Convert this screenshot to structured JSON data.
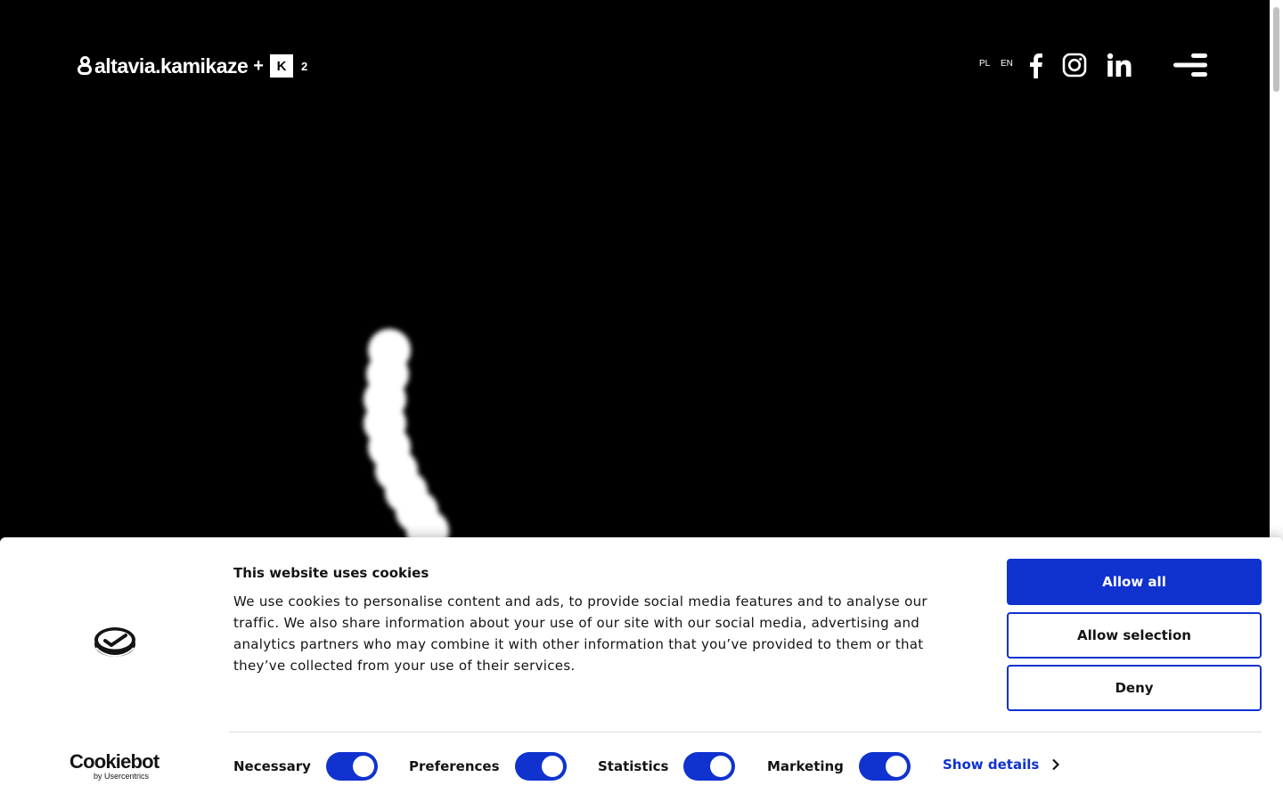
{
  "header": {
    "logo": {
      "brand": "altavia.kamikaze",
      "plus": "+",
      "k_box": "K",
      "superscript": "2"
    },
    "languages": [
      "PL",
      "EN"
    ],
    "social_icons": [
      "facebook-icon",
      "instagram-icon",
      "linkedin-icon"
    ],
    "menu_icon": "hamburger-menu-icon"
  },
  "cookie_banner": {
    "title": "This website uses cookies",
    "body": "We use cookies to personalise content and ads, to provide social media features and to analyse our traffic. We also share information about your use of our site with our social media, advertising and analytics partners who may combine it with other information that you’ve provided to them or that they’ve collected from your use of their services.",
    "buttons": {
      "allow_all": "Allow all",
      "allow_selection": "Allow selection",
      "deny": "Deny"
    },
    "toggles": [
      {
        "label": "Necessary",
        "checked": true
      },
      {
        "label": "Preferences",
        "checked": true
      },
      {
        "label": "Statistics",
        "checked": true
      },
      {
        "label": "Marketing",
        "checked": true
      }
    ],
    "show_details": "Show details",
    "provider": {
      "name": "Cookiebot",
      "by": "by Usercentrics"
    }
  },
  "colors": {
    "accent": "#1032cf",
    "background": "#000000",
    "banner": "#ffffff",
    "text": "#141414"
  }
}
